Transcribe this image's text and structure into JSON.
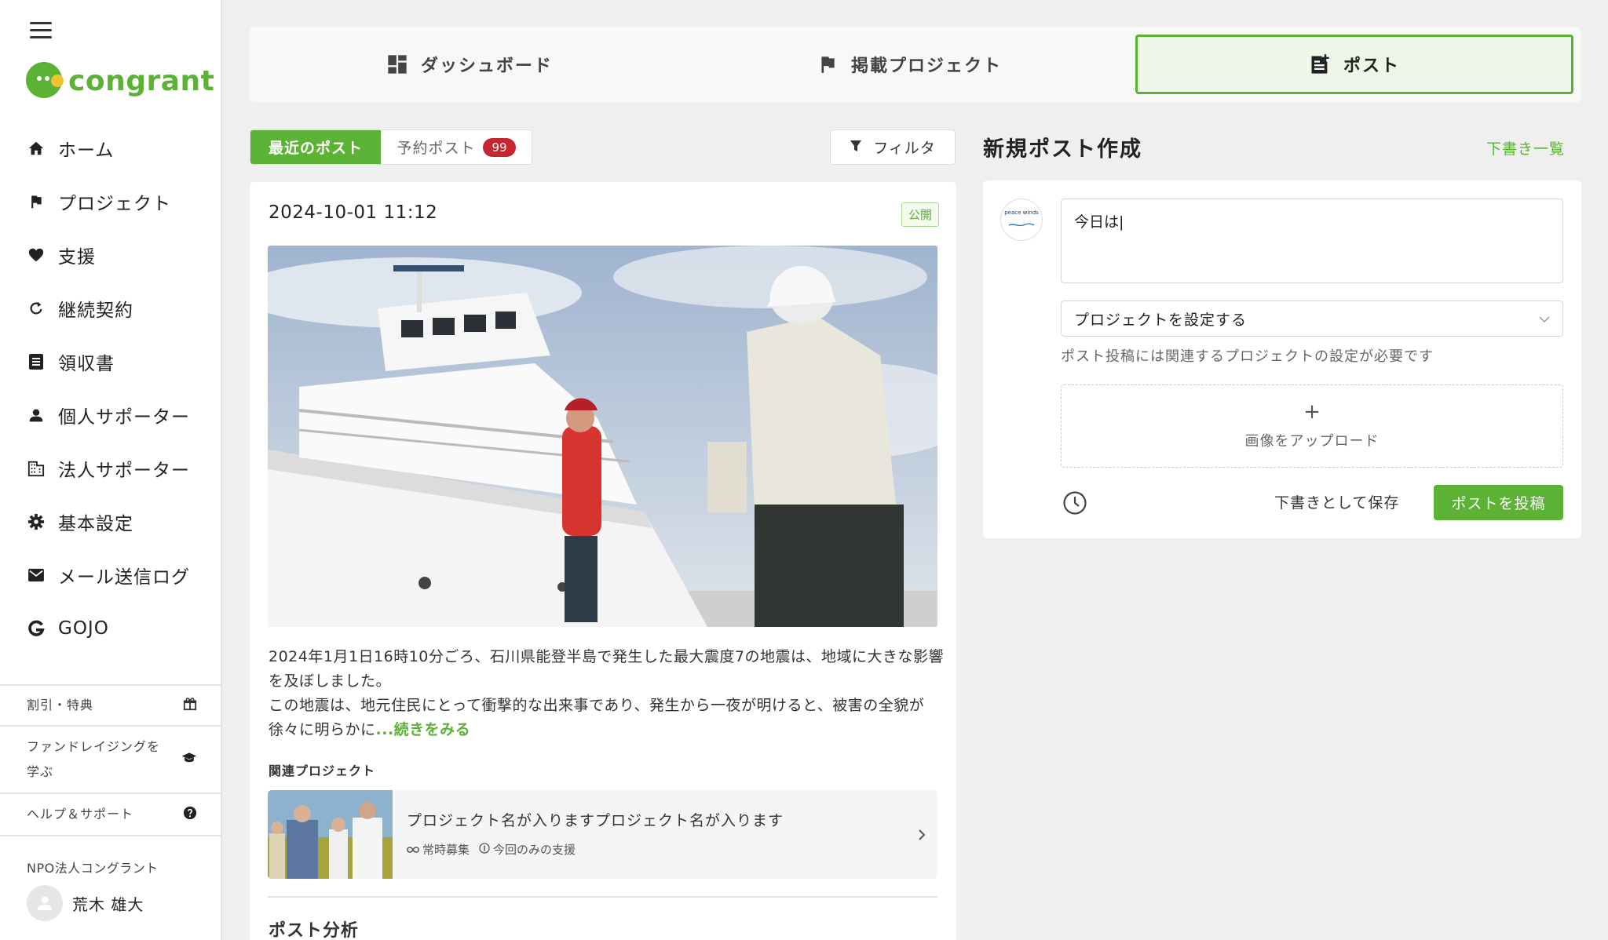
{
  "sidebar": {
    "brand": "congrant",
    "items": [
      {
        "label": "ホーム",
        "icon": "home-icon"
      },
      {
        "label": "プロジェクト",
        "icon": "flag-icon"
      },
      {
        "label": "支援",
        "icon": "heart-icon"
      },
      {
        "label": "継続契約",
        "icon": "refresh-icon"
      },
      {
        "label": "領収書",
        "icon": "receipt-icon"
      },
      {
        "label": "個人サポーター",
        "icon": "person-icon"
      },
      {
        "label": "法人サポーター",
        "icon": "building-icon"
      },
      {
        "label": "基本設定",
        "icon": "gear-icon"
      },
      {
        "label": "メール送信ログ",
        "icon": "mail-icon"
      },
      {
        "label": "GOJO",
        "icon": "gojo-icon"
      }
    ],
    "links": [
      {
        "label": "割引・特典",
        "icon": "gift-icon"
      },
      {
        "label": "ファンドレイジングを学ぶ",
        "icon": "graduation-cap-icon"
      },
      {
        "label": "ヘルプ＆サポート",
        "icon": "help-icon"
      }
    ],
    "org_name": "NPO法人コングラント",
    "user_name": "荒木 雄大"
  },
  "top_tabs": [
    {
      "label": "ダッシュボード",
      "icon": "dashboard-icon",
      "active": false
    },
    {
      "label": "掲載プロジェクト",
      "icon": "flag-icon",
      "active": false
    },
    {
      "label": "ポスト",
      "icon": "post-add-icon",
      "active": true
    }
  ],
  "posts": {
    "tab_recent": "最近のポスト",
    "tab_scheduled": "予約ポスト",
    "scheduled_count": "99",
    "filter_label": "フィルタ",
    "item": {
      "date": "2024-10-01 11:12",
      "status": "公開",
      "body": "2024年1月1日16時10分ごろ、石川県能登半島で発生した最大震度7の地震は、地域に大きな影響を及ぼしました。\nこの地震は、地元住民にとって衝撃的な出来事であり、発生から一夜が明けると、被害の全貌が徐々に明らかに",
      "read_more": "...続きをみる",
      "related_title": "関連プロジェクト",
      "related_project": {
        "name": "プロジェクト名が入りますプロジェクト名が入ります",
        "meta1": "常時募集",
        "meta2": "今回のみの支援"
      }
    },
    "analysis_title": "ポスト分析"
  },
  "compose": {
    "title": "新規ポスト作成",
    "drafts_link": "下書き一覧",
    "org_logo_text": "peace winds",
    "text_value": "今日は|",
    "project_placeholder": "プロジェクトを設定する",
    "hint": "ポスト投稿には関連するプロジェクトの設定が必要です",
    "upload_plus": "+",
    "upload_label": "画像をアップロード",
    "save_draft": "下書きとして保存",
    "submit": "ポストを投稿"
  },
  "colors": {
    "accent": "#5bb235",
    "badge": "#c6262e",
    "background": "#efefef"
  }
}
